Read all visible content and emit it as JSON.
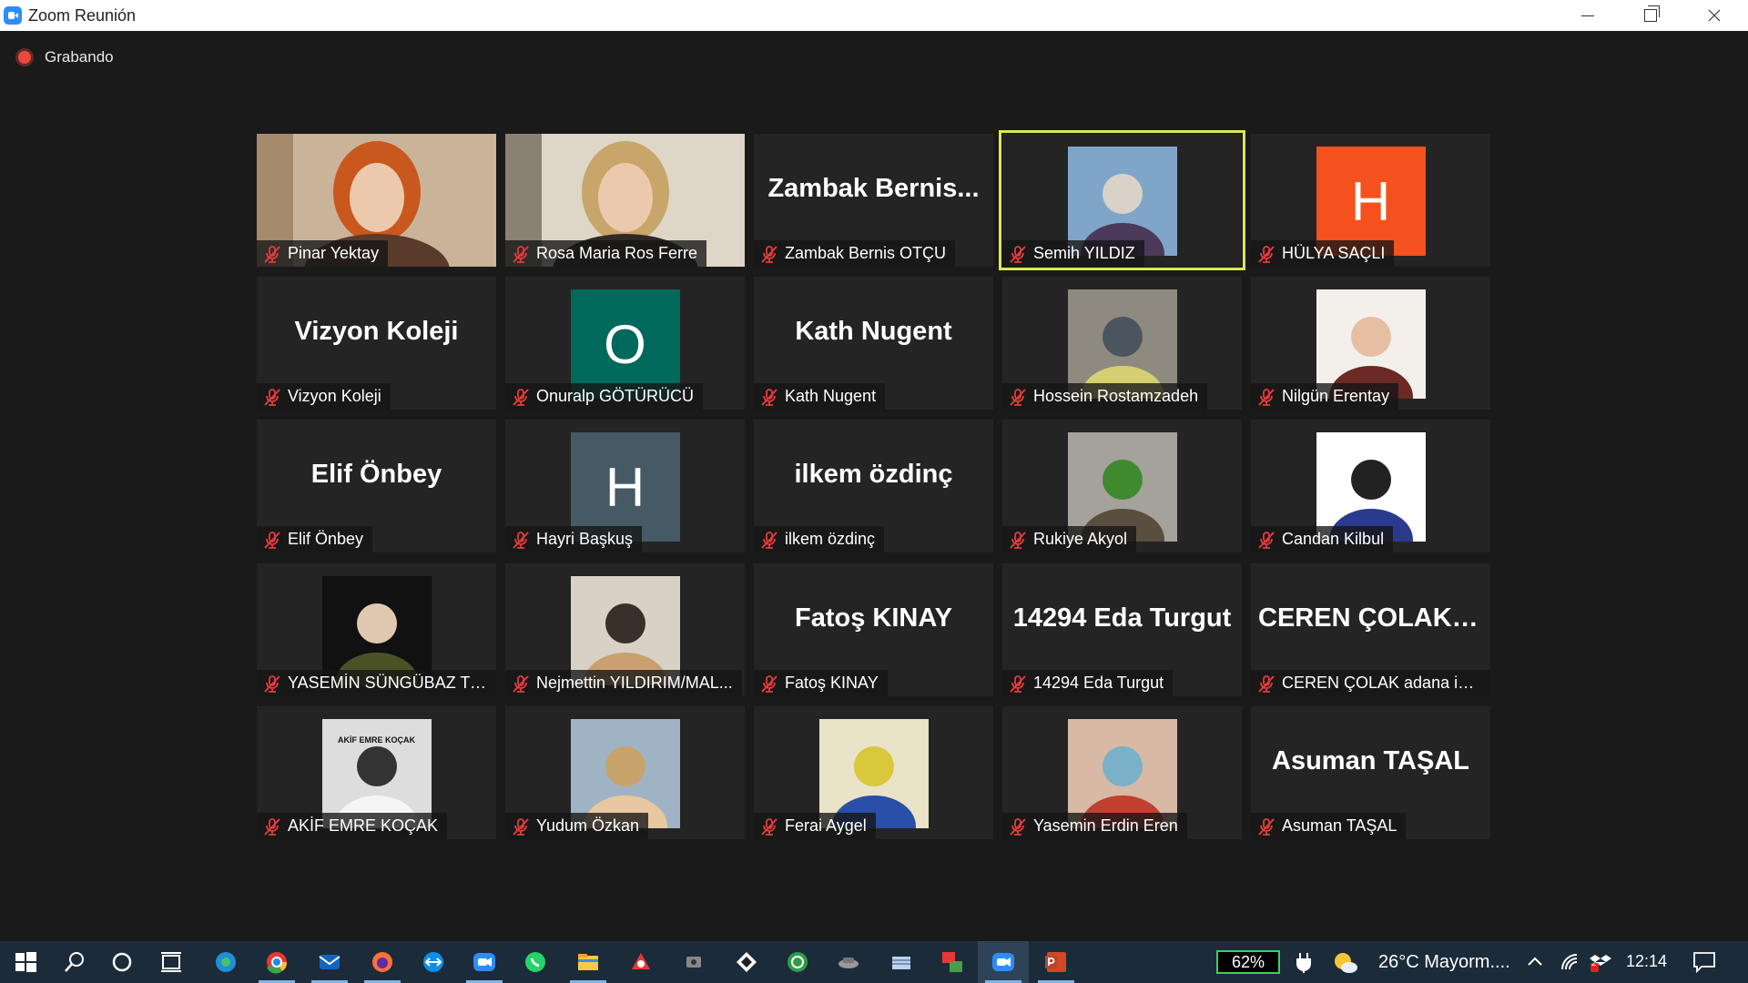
{
  "window": {
    "title": "Zoom Reunión"
  },
  "recording": {
    "label": "Grabando",
    "color": "#e84b3d"
  },
  "active_speaker_color": "#d8e85a",
  "participants": [
    {
      "name": "Pinar Yektay",
      "type": "photo"
    },
    {
      "name": "Rosa Maria Ros Ferre",
      "type": "photo"
    },
    {
      "name": "Zambak Bernis OTÇU",
      "type": "text",
      "display": "Zambak  Bernis..."
    },
    {
      "name": "Semih YILDIZ",
      "type": "photo",
      "active": true
    },
    {
      "name": "HÜLYA SAÇLI",
      "type": "letter",
      "letter": "H",
      "color": "#f4511e"
    },
    {
      "name": "Vizyon Koleji",
      "type": "text",
      "display": "Vizyon Koleji"
    },
    {
      "name": "Onuralp GÖTÜRÜCÜ",
      "type": "letter",
      "letter": "O",
      "color": "#00695c"
    },
    {
      "name": "Kath Nugent",
      "type": "text",
      "display": "Kath Nugent"
    },
    {
      "name": "Hossein Rostamzadeh",
      "type": "photo"
    },
    {
      "name": "Nilgün Erentay",
      "type": "photo"
    },
    {
      "name": "Elif Önbey",
      "type": "text",
      "display": "Elif Önbey"
    },
    {
      "name": "Hayri Başkuş",
      "type": "letter",
      "letter": "H",
      "color": "#455a64"
    },
    {
      "name": "ilkem özdinç",
      "type": "text",
      "display": "ilkem özdinç"
    },
    {
      "name": "Rukiye Akyol",
      "type": "photo"
    },
    {
      "name": "Candan Kilbul",
      "type": "photo"
    },
    {
      "name": "YASEMİN SÜNGÜBAZ TOK",
      "type": "photo"
    },
    {
      "name": "Nejmettin YILDIRIM/MAL...",
      "type": "photo"
    },
    {
      "name": "Fatoş KINAY",
      "type": "text",
      "display": "Fatoş KINAY"
    },
    {
      "name": "14294 Eda Turgut",
      "type": "text",
      "display": "14294 Eda Turgut"
    },
    {
      "name": "CEREN ÇOLAK adana ism...",
      "type": "text",
      "display": "CEREN  ÇOLAK  a..."
    },
    {
      "name": "AKİF EMRE KOÇAK",
      "type": "photo",
      "photo_caption": "AKİF EMRE KOÇAK"
    },
    {
      "name": "Yudum Özkan",
      "type": "photo"
    },
    {
      "name": "Ferai Aygel",
      "type": "photo"
    },
    {
      "name": "Yasemin Erdin Eren",
      "type": "photo"
    },
    {
      "name": "Asuman TAŞAL",
      "type": "text",
      "display": "Asuman TAŞAL"
    }
  ],
  "taskbar": {
    "battery": "62%",
    "weather": "26°C  Mayorm....",
    "time": "12:14",
    "notification_count": "2",
    "apps": [
      "start-icon",
      "search-icon",
      "cortana-icon",
      "task-view-icon",
      "edge-icon",
      "chrome-icon",
      "mail-icon",
      "firefox-icon",
      "teamviewer-icon",
      "zoom-icon",
      "whatsapp-icon",
      "file-explorer-icon",
      "app-red-icon",
      "app-dark-icon",
      "app-inkscape-icon",
      "app-green-icon",
      "app-car-icon",
      "app-files-icon",
      "pdf-to-jpg-icon",
      "zoom-meeting-icon",
      "powerpoint-icon"
    ]
  }
}
